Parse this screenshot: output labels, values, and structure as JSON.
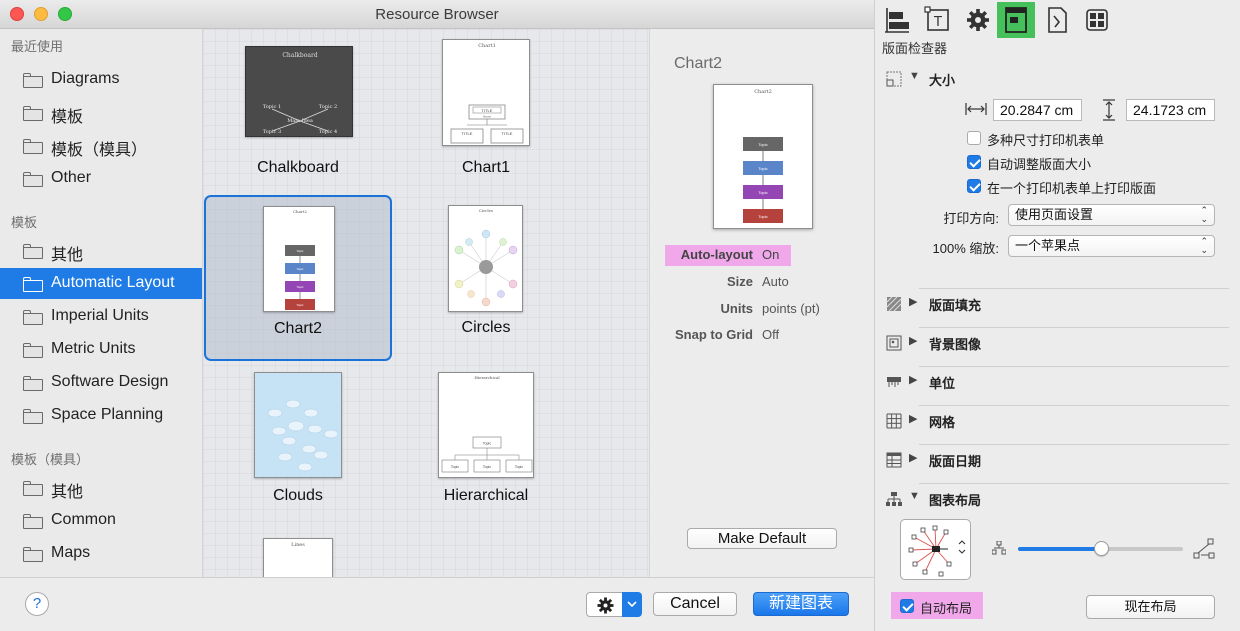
{
  "window": {
    "title": "Resource Browser"
  },
  "sidebar": {
    "sections": [
      {
        "header": "最近使用",
        "items": [
          "Diagrams",
          "模板",
          "模板（模具）",
          "Other"
        ]
      },
      {
        "header": "模板",
        "items": [
          "其他",
          "Automatic Layout",
          "Imperial Units",
          "Metric Units",
          "Software Design",
          "Space Planning"
        ]
      },
      {
        "header": "模板（模具）",
        "items": [
          "其他",
          "Common",
          "Maps"
        ]
      }
    ],
    "selected": "Automatic Layout"
  },
  "templates": [
    {
      "name": "Chalkboard",
      "thumb_title": "Chalkboard",
      "thumb_texts": [
        "Topic 1",
        "Topic 2",
        "Main Idea",
        "Topic 3",
        "Topic 4"
      ]
    },
    {
      "name": "Chart1",
      "thumb_title": "Chart1",
      "thumb_texts": [
        "TITLE",
        "Name",
        "TITLE",
        "TITLE"
      ]
    },
    {
      "name": "Chart2",
      "thumb_title": "Chart2",
      "thumb_texts": [
        "Topic",
        "Topic",
        "Topic",
        "Topic"
      ],
      "selected": true
    },
    {
      "name": "Circles",
      "thumb_title": "Circles",
      "thumb_texts": []
    },
    {
      "name": "Clouds",
      "thumb_title": "",
      "thumb_texts": []
    },
    {
      "name": "Hierarchical",
      "thumb_title": "Hierarchical",
      "thumb_texts": [
        "Topic",
        "Topic",
        "Topic",
        "Topic"
      ]
    },
    {
      "name": "",
      "thumb_title": "Lines",
      "thumb_texts": []
    }
  ],
  "preview": {
    "title": "Chart2",
    "thumb_title": "Chart2",
    "thumb_texts": [
      "Topic",
      "Topic",
      "Topic",
      "Topic"
    ],
    "properties": [
      {
        "key": "Auto-layout",
        "value": "On",
        "highlight": true
      },
      {
        "key": "Size",
        "value": "Auto"
      },
      {
        "key": "Units",
        "value": "points (pt)"
      },
      {
        "key": "Snap to Grid",
        "value": "Off"
      }
    ],
    "make_default": "Make Default"
  },
  "bottom": {
    "help": "?",
    "cancel": "Cancel",
    "create": "新建图表"
  },
  "inspector": {
    "title": "版面检查器",
    "tools": [
      "canvas-align-icon",
      "text-icon",
      "gear-icon",
      "canvas-inspector-icon",
      "document-icon",
      "grid-icon"
    ],
    "size_section": {
      "title": "大小",
      "width": "20.2847 cm",
      "height": "24.1723 cm",
      "checkboxes": [
        {
          "label": "多种尺寸打印机表单",
          "checked": false
        },
        {
          "label": "自动调整版面大小",
          "checked": true
        },
        {
          "label": "在一个打印机表单上打印版面",
          "checked": true
        }
      ],
      "orientation_label": "打印方向:",
      "orientation_value": "使用页面设置",
      "scale_label": "100% 缩放:",
      "scale_value": "一个苹果点"
    },
    "sections": [
      {
        "title": "版面填充",
        "icon": "fill-icon"
      },
      {
        "title": "背景图像",
        "icon": "image-icon"
      },
      {
        "title": "单位",
        "icon": "ruler-icon"
      },
      {
        "title": "网格",
        "icon": "grid-icon"
      },
      {
        "title": "版面日期",
        "icon": "table-icon"
      }
    ],
    "layout_section": {
      "title": "图表布局",
      "auto_layout_label": "自动布局",
      "auto_layout_checked": true,
      "layout_now": "现在布局",
      "spacing_level": 0.5
    }
  }
}
